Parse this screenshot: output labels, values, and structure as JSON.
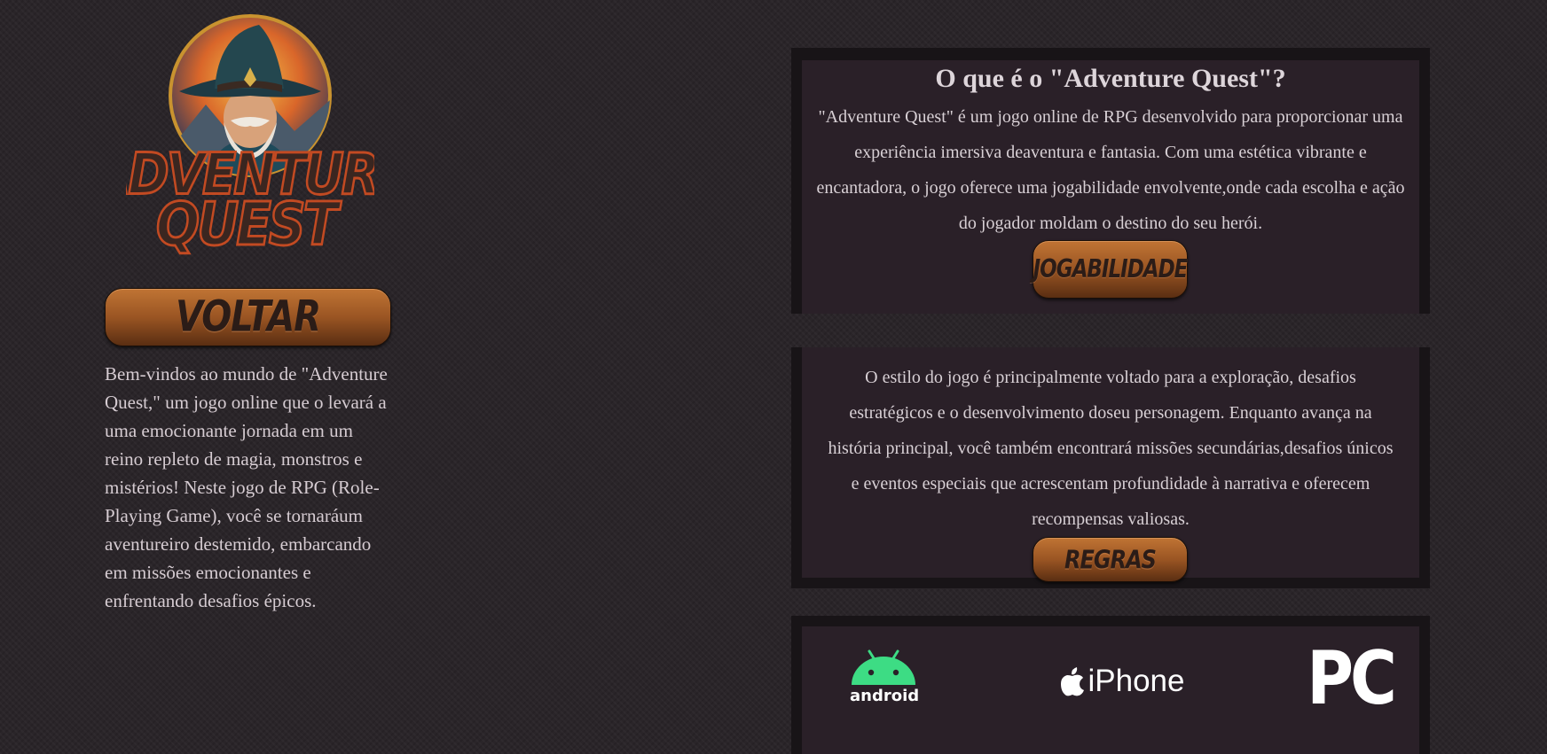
{
  "logo": {
    "line1": "ADVENTURE",
    "line2": "QUEST"
  },
  "buttons": {
    "back": "VOLTAR",
    "gameplay": "JOGABILIDADE",
    "rules": "REGRAS"
  },
  "intro": "Bem-vindos ao mundo de \"Adventure Quest,\" um jogo online que o levará a uma emocionante jornada em um reino repleto de magia, monstros e mistérios! Neste jogo de RPG (Role-Playing Game), você se tornaráum aventureiro destemido, embarcando em missões emocionantes e enfrentando desafios épicos.",
  "about": {
    "title": "O que é o \"Adventure Quest\"?",
    "text": "\"Adventure Quest\" é um jogo online de RPG desenvolvido para proporcionar uma experiência imersiva deaventura e fantasia. Com uma estética vibrante e encantadora, o jogo oferece uma jogabilidade envolvente,onde cada escolha e ação do jogador moldam o destino do seu herói."
  },
  "style": {
    "text": "O estilo do jogo é principalmente voltado para a exploração, desafios estratégicos e o desenvolvimento doseu personagem. Enquanto avança na história principal, você também encontrará missões secundárias,desafios únicos e eventos especiais que acrescentam profundidade à narrativa e oferecem recompensas valiosas."
  },
  "platforms": {
    "android": "android",
    "iphone": "iPhone",
    "pc": "PC"
  },
  "colors": {
    "background": "#2a2529",
    "panel_border": "#181417",
    "panel_fill": "#2a2028",
    "button_top": "#c07434",
    "button_bottom": "#5a2e12",
    "android_green": "#3ddc84",
    "logo_text": "#3a2620",
    "logo_outline": "#c24a22"
  },
  "icons": {
    "android": "android-robot-icon",
    "apple": "apple-logo-icon"
  }
}
